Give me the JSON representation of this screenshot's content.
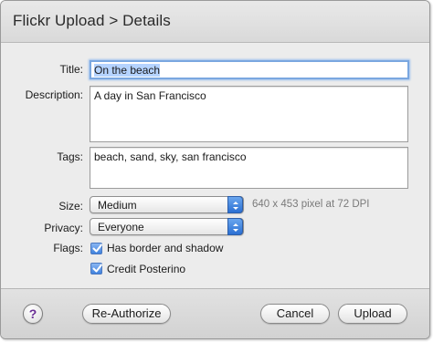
{
  "dialog": {
    "title": "Flickr Upload > Details"
  },
  "form": {
    "title_label": "Title:",
    "title_value": "On the beach",
    "description_label": "Description:",
    "description_value": "A day in San Francisco",
    "tags_label": "Tags:",
    "tags_value": "beach, sand, sky, san francisco",
    "size_label": "Size:",
    "size_value": "Medium",
    "size_hint": "640 x 453 pixel at 72 DPI",
    "privacy_label": "Privacy:",
    "privacy_value": "Everyone",
    "flags_label": "Flags:",
    "flags": [
      {
        "label": "Has border and shadow",
        "checked": true
      },
      {
        "label": "Credit Posterino",
        "checked": true
      }
    ]
  },
  "footer": {
    "help_glyph": "?",
    "reauthorize_label": "Re-Authorize",
    "cancel_label": "Cancel",
    "upload_label": "Upload"
  },
  "colors": {
    "accent": "#3f82de",
    "focus_ring": "#7aa7e0",
    "selection": "#b5d3ff",
    "hint_text": "#7a7a7a"
  },
  "icons": {
    "help": "help-icon",
    "popup_arrows": "popup-arrows-icon",
    "checkmark": "checkmark-icon"
  }
}
